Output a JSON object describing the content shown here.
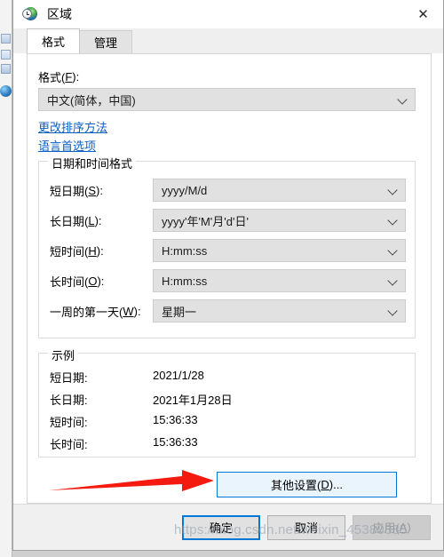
{
  "window": {
    "title": "区域",
    "icon": "region-globe-clock-icon",
    "close_label": "✕"
  },
  "tabs": [
    {
      "label": "格式",
      "active": true
    },
    {
      "label": "管理",
      "active": false
    }
  ],
  "format_section": {
    "label": "格式(F):",
    "label_text": "格式(",
    "label_accel": "F",
    "label_tail": "):",
    "value": "中文(简体，中国)"
  },
  "links": [
    {
      "label": "更改排序方法"
    },
    {
      "label": "语言首选项"
    }
  ],
  "datetime_group": {
    "legend": "日期和时间格式",
    "rows": [
      {
        "label_head": "短日期(",
        "accel": "S",
        "label_tail": "):",
        "value": "yyyy/M/d"
      },
      {
        "label_head": "长日期(",
        "accel": "L",
        "label_tail": "):",
        "value": "yyyy'年'M'月'd'日'"
      },
      {
        "label_head": "短时间(",
        "accel": "H",
        "label_tail": "):",
        "value": "H:mm:ss"
      },
      {
        "label_head": "长时间(",
        "accel": "O",
        "label_tail": "):",
        "value": "H:mm:ss"
      },
      {
        "label_head": "一周的第一天(",
        "accel": "W",
        "label_tail": "):",
        "value": "星期一"
      }
    ]
  },
  "examples_group": {
    "legend": "示例",
    "rows": [
      {
        "label": "短日期:",
        "value": "2021/1/28"
      },
      {
        "label": "长日期:",
        "value": "2021年1月28日"
      },
      {
        "label": "短时间:",
        "value": "15:36:33"
      },
      {
        "label": "长时间:",
        "value": "15:36:33"
      }
    ]
  },
  "other_settings_button": {
    "head": "其他设置(",
    "accel": "D",
    "tail": ")..."
  },
  "command_buttons": [
    {
      "label": "确定",
      "state": "focused"
    },
    {
      "label": "取消",
      "state": "normal"
    },
    {
      "label_head": "应用(",
      "accel": "A",
      "label_tail": ")",
      "state": "disabled"
    }
  ],
  "annotation": {
    "arrow_color": "#f41a10"
  },
  "watermark": {
    "text": "https://blog.csdn.net/weixin_45380885"
  }
}
